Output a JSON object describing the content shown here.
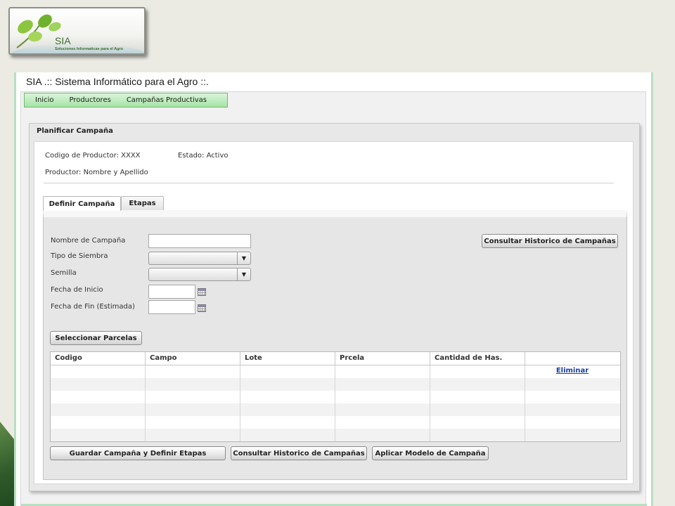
{
  "logo": {
    "name": "SIA",
    "tagline": "Soluciones Informaticas para el Agro"
  },
  "window": {
    "title": "SIA .:: Sistema Informático para el Agro ::."
  },
  "menu": {
    "items": [
      {
        "label": "Inicio"
      },
      {
        "label": "Productores"
      },
      {
        "label": "Campañas Productivas"
      }
    ]
  },
  "panel": {
    "title": "Planificar Campaña",
    "producer_code": "Codigo de Productor: XXXX",
    "status": "Estado: Activo",
    "producer_name": "Productor: Nombre y Apellido"
  },
  "tabs": [
    {
      "label": "Definir Campaña",
      "active": true
    },
    {
      "label": "Etapas",
      "active": false
    }
  ],
  "form": {
    "campaign_name_label": "Nombre de Campaña",
    "campaign_name_value": "",
    "sowing_type_label": "Tipo de Siembra",
    "sowing_type_value": "",
    "seed_label": "Semilla",
    "seed_value": "",
    "start_date_label": "Fecha de Inicio",
    "start_date_value": "",
    "end_date_label": "Fecha de Fin (Estimada)",
    "end_date_value": "",
    "history_button": "Consultar Historico de Campañas",
    "select_plots_button": "Seleccionar Parcelas"
  },
  "table": {
    "columns": [
      "Codigo",
      "Campo",
      "Lote",
      "Prcela",
      "Cantidad de Has.",
      ""
    ],
    "delete_link": "Eliminar"
  },
  "actions": {
    "save": "Guardar Campaña y Definir Etapas",
    "history": "Consultar Historico de Campañas",
    "apply_model": "Aplicar Modelo de Campaña"
  }
}
